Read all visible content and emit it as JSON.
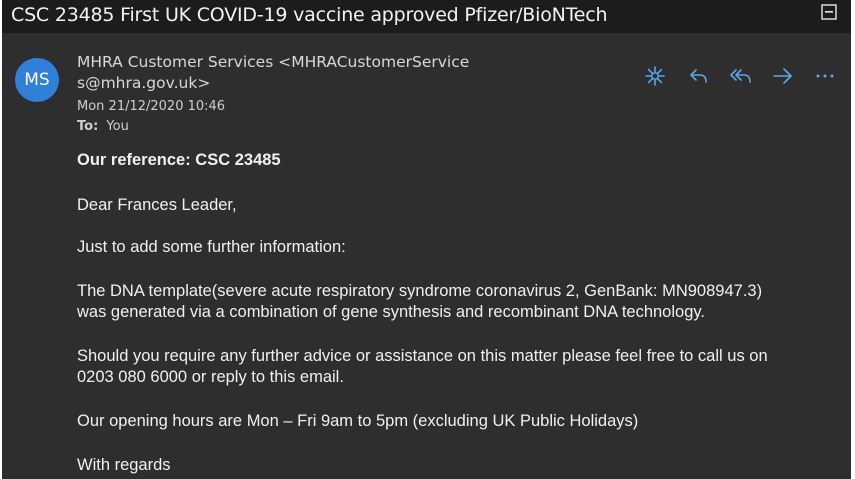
{
  "email": {
    "subject": "CSC 23485 First UK COVID-19 vaccine approved Pfizer/BioNTech",
    "avatar_initials": "MS",
    "sender_line1": "MHRA Customer Services <MHRACustomerService",
    "sender_line2": "s@mhra.gov.uk>",
    "date": "Mon 21/12/2020 10:46",
    "to_label": "To:",
    "to_value": "You"
  },
  "actions": [
    {
      "icon": "sparkle-icon"
    },
    {
      "icon": "reply-icon"
    },
    {
      "icon": "reply-all-icon"
    },
    {
      "icon": "forward-icon"
    },
    {
      "icon": "more-icon"
    }
  ],
  "body": {
    "reference": "Our reference: CSC 23485",
    "greeting": "Dear Frances Leader,",
    "intro": "Just to add some further information:",
    "dna_line1": "The DNA template(severe acute respiratory syndrome coronavirus 2, GenBank: MN908947.3)",
    "dna_line2": "was generated via a combination of gene synthesis and recombinant DNA technology.",
    "advice_line1": "Should you require any further advice or assistance on this matter please feel free to call us on",
    "advice_line2": "0203 080 6000 or reply to this email.",
    "hours": "Our opening hours are Mon – Fri 9am to 5pm (excluding UK Public Holidays)",
    "closing": "With regards"
  },
  "colors": {
    "background": "#2e2e2e",
    "title_bar": "#1c1c1c",
    "avatar": "#2f80d8",
    "action_icons": "#5aa7f0"
  }
}
